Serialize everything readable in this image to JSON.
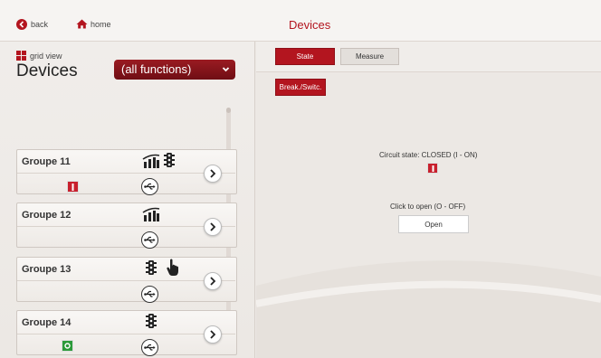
{
  "nav": {
    "back_label": "back",
    "home_label": "home"
  },
  "page_title": "Devices",
  "view": {
    "grid_view_label": "grid view"
  },
  "devices_heading": "Devices",
  "function_filter": {
    "selected": "(all functions)"
  },
  "groups": [
    {
      "name": "Groupe 11",
      "icons": [
        "signal-bars-icon",
        "traffic-light-icon"
      ],
      "state": {
        "kind": "on",
        "label": "I"
      },
      "connection": "usb-icon"
    },
    {
      "name": "Groupe 12",
      "icons": [
        "signal-bars-icon"
      ],
      "state": null,
      "connection": "usb-icon"
    },
    {
      "name": "Groupe 13",
      "icons": [
        "traffic-light-icon",
        "hand-pointer-icon"
      ],
      "state": null,
      "connection": "usb-icon"
    },
    {
      "name": "Groupe 14",
      "icons": [
        "traffic-light-icon"
      ],
      "state": {
        "kind": "off",
        "label": "O"
      },
      "connection": "usb-icon"
    }
  ],
  "tabs": {
    "state": "State",
    "measure": "Measure"
  },
  "subtabs": {
    "break_switch": "Break./Switc."
  },
  "circuit": {
    "state_text": "Circuit state: CLOSED (I - ON)",
    "indicator_label": "I",
    "action_text": "Click to open (O - OFF)",
    "open_button": "Open"
  },
  "colors": {
    "accent": "#b3151f",
    "on": "#c8202d",
    "off": "#2c9a3a"
  }
}
